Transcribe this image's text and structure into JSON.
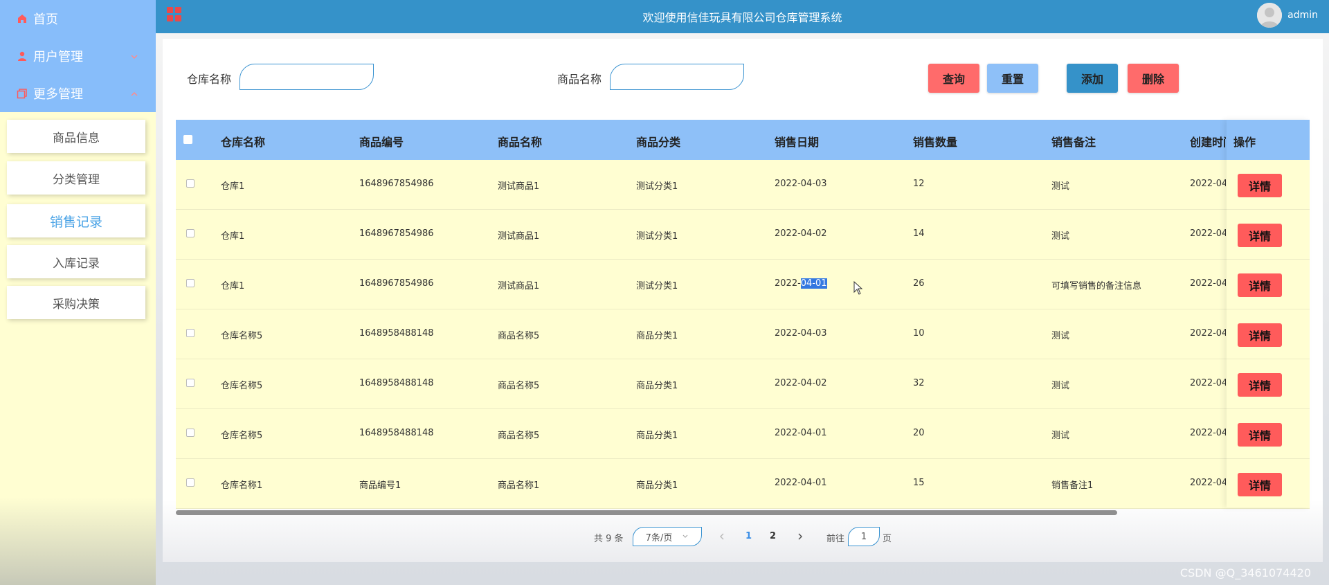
{
  "sidebar": {
    "menu": [
      {
        "label": "首页",
        "icon": "home-icon"
      },
      {
        "label": "用户管理",
        "icon": "user-icon"
      },
      {
        "label": "更多管理",
        "icon": "copy-icon"
      }
    ],
    "expand_icon": "chevron-down-icon",
    "collapse_icon": "chevron-up-icon",
    "subitems": [
      {
        "label": "商品信息"
      },
      {
        "label": "分类管理"
      },
      {
        "label": "销售记录",
        "active": true
      },
      {
        "label": "入库记录"
      },
      {
        "label": "采购决策"
      }
    ]
  },
  "header": {
    "title": "欢迎使用信佳玩具有限公司仓库管理系统",
    "username": "admin",
    "menu_icon": "grid-menu-icon"
  },
  "search": {
    "warehouse_label": "仓库名称",
    "warehouse_value": "",
    "product_label": "商品名称",
    "product_value": ""
  },
  "buttons": {
    "query": "查询",
    "reset": "重置",
    "add": "添加",
    "delete": "删除"
  },
  "colors": {
    "header_bg": "#3592c9",
    "table_header_bg": "#8ec0f8",
    "row_bg": "#fffed2",
    "danger": "#ff5b5b",
    "query_btn": "#ff6b6b",
    "reset_btn": "#8ec0f8",
    "add_btn": "#3592c9"
  },
  "table": {
    "columns": [
      "仓库名称",
      "商品编号",
      "商品名称",
      "商品分类",
      "销售日期",
      "销售数量",
      "销售备注",
      "创建时间",
      "操作"
    ],
    "detail_label": "详情",
    "rows": [
      {
        "warehouse": "仓库1",
        "code": "1648967854986",
        "name": "测试商品1",
        "category": "测试分类1",
        "date": "2022-04-03",
        "qty": "12",
        "note": "测试",
        "created": "2022-04"
      },
      {
        "warehouse": "仓库1",
        "code": "1648967854986",
        "name": "测试商品1",
        "category": "测试分类1",
        "date": "2022-04-02",
        "qty": "14",
        "note": "测试",
        "created": "2022-04"
      },
      {
        "warehouse": "仓库1",
        "code": "1648967854986",
        "name": "测试商品1",
        "category": "测试分类1",
        "date_prefix": "2022-",
        "date_selected": "04-01",
        "qty": "26",
        "note": "可填写销售的备注信息",
        "created": "2022-04"
      },
      {
        "warehouse": "仓库名称5",
        "code": "1648958488148",
        "name": "商品名称5",
        "category": "商品分类1",
        "date": "2022-04-03",
        "qty": "10",
        "note": "测试",
        "created": "2022-04"
      },
      {
        "warehouse": "仓库名称5",
        "code": "1648958488148",
        "name": "商品名称5",
        "category": "商品分类1",
        "date": "2022-04-02",
        "qty": "32",
        "note": "测试",
        "created": "2022-04"
      },
      {
        "warehouse": "仓库名称5",
        "code": "1648958488148",
        "name": "商品名称5",
        "category": "商品分类1",
        "date": "2022-04-01",
        "qty": "20",
        "note": "测试",
        "created": "2022-04"
      },
      {
        "warehouse": "仓库名称1",
        "code": "商品编号1",
        "name": "商品名称1",
        "category": "商品分类1",
        "date": "2022-04-01",
        "qty": "15",
        "note": "销售备注1",
        "created": "2022-04"
      }
    ]
  },
  "pagination": {
    "total": "共 9 条",
    "page_size": "7条/页",
    "pages": [
      "1",
      "2"
    ],
    "current": "1",
    "goto_prefix": "前往",
    "goto_value": "1",
    "goto_suffix": "页"
  },
  "watermark": "CSDN @Q_3461074420"
}
